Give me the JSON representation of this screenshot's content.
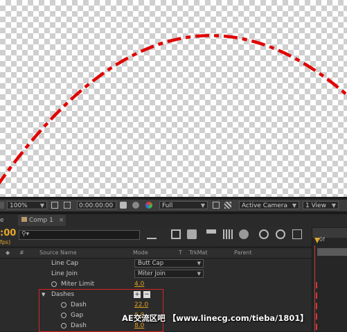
{
  "viewer_toolbar": {
    "zoom": "100%",
    "timecode": "0:00:00:00",
    "resolution": "Full",
    "camera": "Active Camera",
    "view": "1 View"
  },
  "tabs": {
    "partial_left": "e",
    "comp": "Comp 1"
  },
  "timeline": {
    "timecode": ":00",
    "fps": "fps)",
    "columns": {
      "num": "#",
      "source": "Source Name",
      "mode": "Mode",
      "t": "T",
      "trkmat": "TrkMat",
      "parent": "Parent"
    },
    "rows": [
      {
        "label": "Line Cap",
        "select": "Butt Cap"
      },
      {
        "label": "Line Join",
        "select": "Miter Join"
      },
      {
        "label": "Miter Limit",
        "value": "4.0"
      },
      {
        "label": "Dashes"
      },
      {
        "label": "Dash",
        "value": "22.0"
      },
      {
        "label": "Gap",
        "value": "6.0"
      },
      {
        "label": "Dash",
        "value": "8.0"
      }
    ],
    "ruler_label": "0f"
  },
  "watermark": "AE交流区吧 【www.linecg.com/tieba/1801】",
  "colors": {
    "stroke": "#e00000",
    "accent": "#e6a92c",
    "highlight": "#d22222"
  }
}
